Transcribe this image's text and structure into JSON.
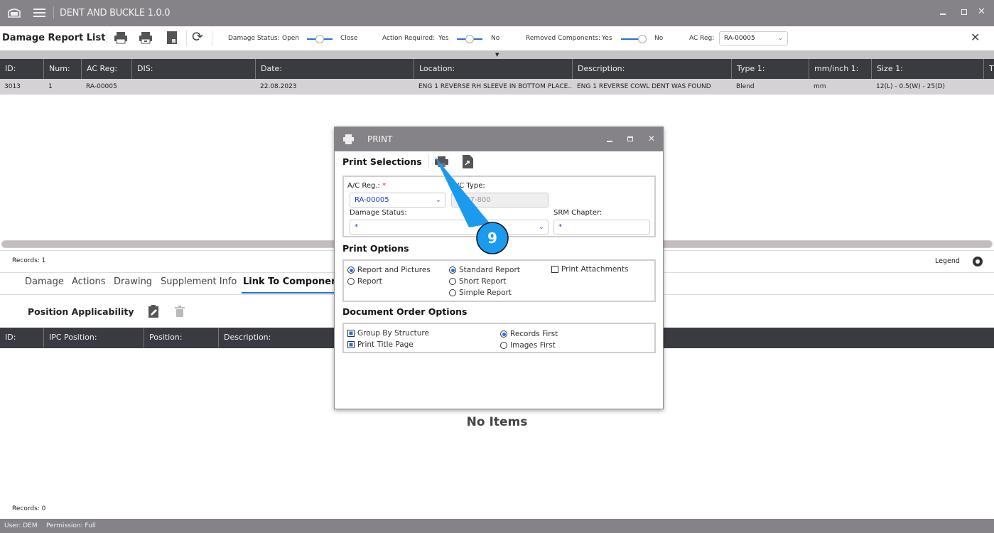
{
  "app": {
    "title": "DENT AND BUCKLE 1.0.0"
  },
  "toolbar": {
    "title": "Damage Report List",
    "damage_status": {
      "label": "Damage Status:",
      "left": "Open",
      "right": "Close"
    },
    "action_required": {
      "label": "Action Required:",
      "left": "Yes",
      "right": "No"
    },
    "removed_components": {
      "label": "Removed Components:",
      "left": "Yes",
      "right": "No"
    },
    "ac_reg": {
      "label": "AC Reg:",
      "value": "RA-00005"
    }
  },
  "damage_table": {
    "columns": [
      "ID:",
      "Num:",
      "AC Reg:",
      "DIS:",
      "Date:",
      "Location:",
      "Description:",
      "Type 1:",
      "mm/inch 1:",
      "Size 1:",
      "T"
    ],
    "rows": [
      [
        "3013",
        "1",
        "RA-00005",
        "",
        "22.08.2023",
        "ENG 1 REVERSE RH SLEEVE IN BOTTOM PLACE...",
        "ENG 1 REVERSE COWL DENT WAS FOUND",
        "Blend",
        "mm",
        "12(L) - 0.5(W) - 25(D)",
        ""
      ]
    ],
    "records": "Records: 1",
    "legend": "Legend"
  },
  "tabs": [
    "Damage",
    "Actions",
    "Drawing",
    "Supplement Info",
    "Link To Component"
  ],
  "position": {
    "title": "Position Applicability",
    "columns": [
      "ID:",
      "IPC Position:",
      "Position:",
      "Description:"
    ],
    "empty": "No Items",
    "records": "Records: 0"
  },
  "status": {
    "user": "User: DEM",
    "permission": "Permission: Full"
  },
  "print_dialog": {
    "title": "PRINT",
    "selections_title": "Print Selections",
    "ac_reg_label": "A/C Reg.:",
    "required_mark": "*",
    "ac_reg_value": "RA-00005",
    "ac_type_label": "A/C Type:",
    "ac_type_value": "B737-800",
    "damage_status_label": "Damage Status:",
    "damage_status_value": "*",
    "srm_label": "SRM Chapter:",
    "srm_value": "*",
    "print_options_title": "Print Options",
    "content_options": [
      {
        "label": "Report and Pictures",
        "selected": true
      },
      {
        "label": "Report",
        "selected": false
      }
    ],
    "report_options": [
      {
        "label": "Standard Report",
        "selected": true
      },
      {
        "label": "Short Report",
        "selected": false
      },
      {
        "label": "Simple Report",
        "selected": false
      }
    ],
    "print_attachments": {
      "label": "Print Attachments",
      "checked": false
    },
    "order_title": "Document Order Options",
    "group_by_structure": {
      "label": "Group By Structure",
      "checked": true
    },
    "print_title_page": {
      "label": "Print Title Page",
      "checked": true
    },
    "order_options": [
      {
        "label": "Records First",
        "selected": true
      },
      {
        "label": "Images First",
        "selected": false
      }
    ]
  },
  "callout": {
    "number": "9",
    "color": "#1a9bf0"
  }
}
